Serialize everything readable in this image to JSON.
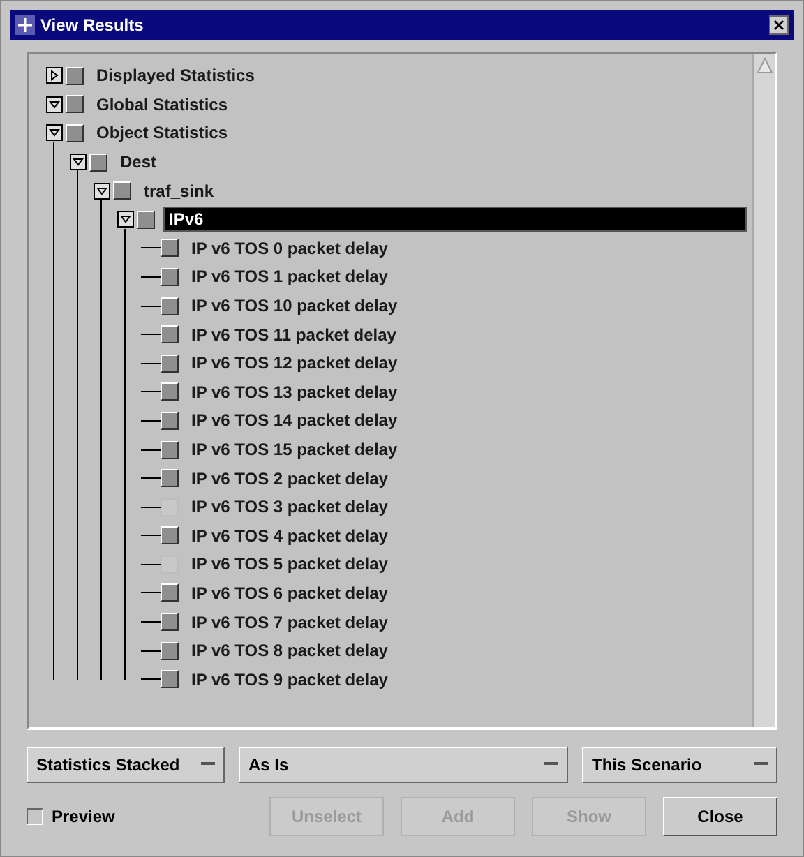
{
  "window": {
    "title": "View Results"
  },
  "tree": [
    {
      "label": "Displayed Statistics",
      "expanded": false,
      "selected": false
    },
    {
      "label": "Global Statistics",
      "expanded": true,
      "selected": false
    },
    {
      "label": "Object Statistics",
      "expanded": true,
      "selected": false,
      "children": [
        {
          "label": "Dest",
          "expanded": true,
          "selected": false,
          "children": [
            {
              "label": "traf_sink",
              "expanded": true,
              "selected": false,
              "children": [
                {
                  "label": "IPv6",
                  "expanded": true,
                  "selected": true,
                  "children": [
                    {
                      "label": "IP v6 TOS 0 packet delay",
                      "selected": false,
                      "dimmed": false
                    },
                    {
                      "label": "IP v6 TOS 1 packet delay",
                      "selected": false,
                      "dimmed": false
                    },
                    {
                      "label": "IP v6 TOS 10 packet delay",
                      "selected": false,
                      "dimmed": false
                    },
                    {
                      "label": "IP v6 TOS 11 packet delay",
                      "selected": false,
                      "dimmed": false
                    },
                    {
                      "label": "IP v6 TOS 12 packet delay",
                      "selected": false,
                      "dimmed": false
                    },
                    {
                      "label": "IP v6 TOS 13 packet delay",
                      "selected": false,
                      "dimmed": false
                    },
                    {
                      "label": "IP v6 TOS 14 packet delay",
                      "selected": false,
                      "dimmed": false
                    },
                    {
                      "label": "IP v6 TOS 15 packet delay",
                      "selected": false,
                      "dimmed": false
                    },
                    {
                      "label": "IP v6 TOS 2 packet delay",
                      "selected": false,
                      "dimmed": false
                    },
                    {
                      "label": "IP v6 TOS 3 packet delay",
                      "selected": false,
                      "dimmed": true
                    },
                    {
                      "label": "IP v6 TOS 4 packet delay",
                      "selected": false,
                      "dimmed": false
                    },
                    {
                      "label": "IP v6 TOS 5 packet delay",
                      "selected": false,
                      "dimmed": true
                    },
                    {
                      "label": "IP v6 TOS 6 packet delay",
                      "selected": false,
                      "dimmed": false
                    },
                    {
                      "label": "IP v6 TOS 7 packet delay",
                      "selected": false,
                      "dimmed": false
                    },
                    {
                      "label": "IP v6 TOS 8 packet delay",
                      "selected": false,
                      "dimmed": false
                    },
                    {
                      "label": "IP v6 TOS 9 packet delay",
                      "selected": false,
                      "dimmed": false
                    }
                  ]
                }
              ]
            }
          ]
        }
      ]
    }
  ],
  "dropdowns": [
    {
      "value": "Statistics Stacked"
    },
    {
      "value": "As Is"
    },
    {
      "value": "This Scenario"
    }
  ],
  "preview": {
    "label": "Preview",
    "checked": false
  },
  "buttons": [
    {
      "label": "Unselect",
      "disabled": true
    },
    {
      "label": "Add",
      "disabled": true
    },
    {
      "label": "Show",
      "disabled": true
    },
    {
      "label": "Close",
      "disabled": false
    }
  ]
}
